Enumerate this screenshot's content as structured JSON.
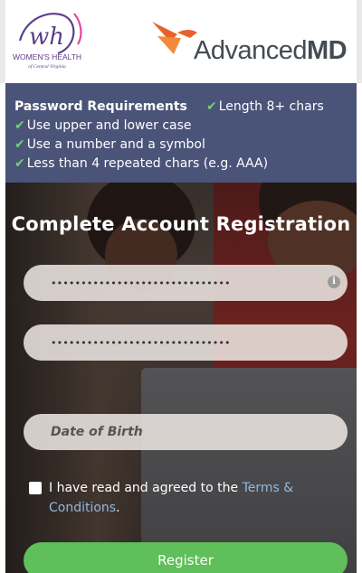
{
  "header": {
    "womens_health_line1": "WOMEN'S HEALTH",
    "womens_health_line2": "of Central Virginia",
    "brand_light": "Advanced",
    "brand_bold": "MD"
  },
  "requirements": {
    "title": "Password Requirements",
    "items": [
      "Length 8+ chars",
      "Use upper and lower case",
      "Use a number and a symbol",
      "Less than 4 repeated chars (e.g. AAA)"
    ]
  },
  "form": {
    "heading": "Complete Account Registration",
    "password_value": "••••••••••••••••••••••••••••••",
    "confirm_value": "••••••••••••••••••••••••••••••",
    "dob_placeholder": "Date of Birth",
    "agree_prefix": "I have read and agreed to the ",
    "terms_link": "Terms & Conditions",
    "agree_suffix": ".",
    "register_label": "Register"
  },
  "colors": {
    "banner": "#4a5478",
    "check": "#6fd36f",
    "register": "#5fbf5a",
    "link": "#8fb8e0",
    "brand_orange": "#e8612c",
    "wh_purple": "#5b3f88"
  }
}
